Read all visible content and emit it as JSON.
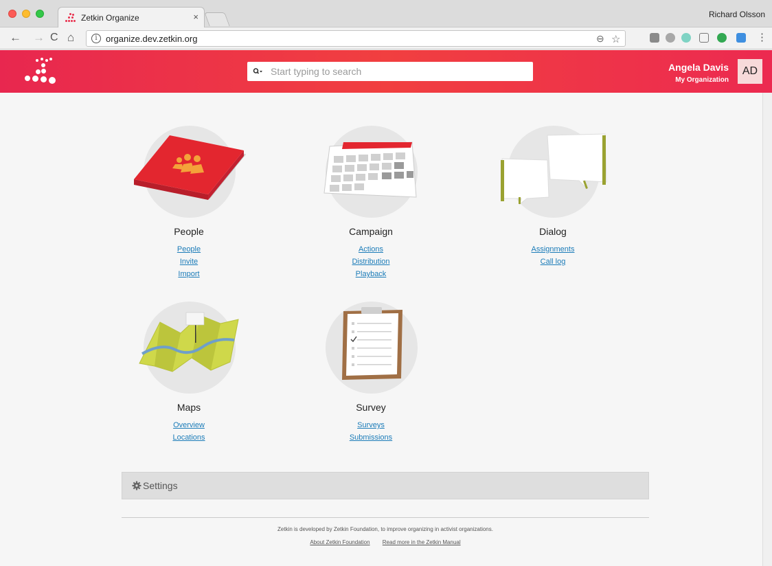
{
  "browser": {
    "tab_title": "Zetkin Organize",
    "tab_close": "×",
    "profile_name": "Richard Olsson",
    "url": "organize.dev.zetkin.org",
    "nav": {
      "back": "←",
      "forward": "→",
      "reload": "C",
      "home": "⌂"
    },
    "info_glyph": "i",
    "zoom_glyph": "⊖",
    "star_glyph": "☆",
    "menu_glyph": "⋮"
  },
  "header": {
    "search_placeholder": "Start typing to search",
    "user_name": "Angela Davis",
    "org_name": "My Organization",
    "avatar_initials": "AD"
  },
  "modules": [
    {
      "title": "People",
      "links": [
        "People",
        "Invite",
        "Import"
      ]
    },
    {
      "title": "Campaign",
      "links": [
        "Actions",
        "Distribution",
        "Playback"
      ]
    },
    {
      "title": "Dialog",
      "links": [
        "Assignments",
        "Call log"
      ]
    },
    {
      "title": "Maps",
      "links": [
        "Overview",
        "Locations"
      ]
    },
    {
      "title": "Survey",
      "links": [
        "Surveys",
        "Submissions"
      ]
    }
  ],
  "settings": {
    "label": "Settings"
  },
  "footer": {
    "text": "Zetkin is developed by Zetkin Foundation, to improve organizing in activist organizations.",
    "links": [
      "About Zetkin Foundation",
      "Read more in the Zetkin Manual"
    ]
  },
  "colors": {
    "brand": "#ee3348",
    "link": "#1a7bb8"
  }
}
